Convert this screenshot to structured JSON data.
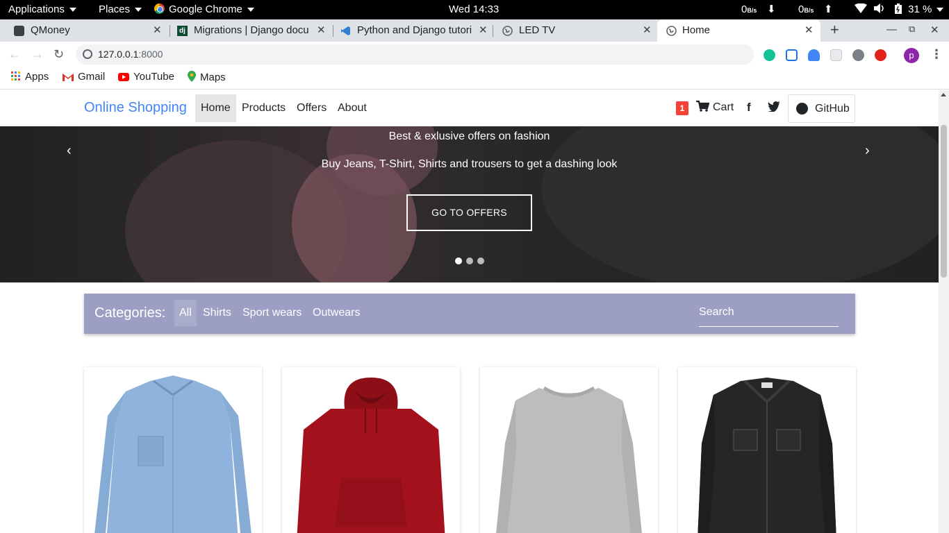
{
  "system_bar": {
    "applications": "Applications",
    "places": "Places",
    "app": "Google Chrome",
    "clock": "Wed 14:33",
    "net_down": "0",
    "net_up": "0",
    "net_unit": "B/s",
    "battery": "31 %"
  },
  "tabs": [
    {
      "title": "QMoney",
      "favicon": "qmoney-icon"
    },
    {
      "title": "Migrations | Django docu",
      "favicon": "django-icon"
    },
    {
      "title": "Python and Django tutori",
      "favicon": "vscode-icon"
    },
    {
      "title": "LED TV",
      "favicon": "globe-icon"
    },
    {
      "title": "Home",
      "favicon": "globe-icon",
      "active": true
    }
  ],
  "address_bar": {
    "host": "127.0.0.1",
    "port": ":8000"
  },
  "extensions": {
    "badge_count": "0",
    "profile_initial": "p"
  },
  "bookmarks": [
    {
      "label": "Apps",
      "icon": "apps-grid-icon"
    },
    {
      "label": "Gmail",
      "icon": "gmail-icon"
    },
    {
      "label": "YouTube",
      "icon": "youtube-icon"
    },
    {
      "label": "Maps",
      "icon": "maps-pin-icon"
    }
  ],
  "site": {
    "brand": "Online Shopping",
    "nav": [
      "Home",
      "Products",
      "Offers",
      "About"
    ],
    "active_nav": "Home",
    "cart_count": "1",
    "cart_label": "Cart",
    "facebook_glyph": "f",
    "github_label": "GitHub"
  },
  "hero": {
    "heading": "Best & exlusive offers on fashion",
    "subheading": "Buy Jeans, T-Shirt, Shirts and trousers to get a dashing look",
    "button": "GO TO OFFERS",
    "slides": 3,
    "active_slide": 1
  },
  "categories": {
    "title": "Categories:",
    "items": [
      "All",
      "Shirts",
      "Sport wears",
      "Outwears"
    ],
    "active": "All",
    "search_placeholder": "Search"
  },
  "products": [
    {
      "image": "denim-shirt",
      "color": "#8fb3dc"
    },
    {
      "image": "red-hoodie",
      "color": "#a3111d"
    },
    {
      "image": "grey-sweatshirt",
      "color": "#bdbdbd"
    },
    {
      "image": "black-denim-jacket",
      "color": "#262626"
    }
  ]
}
